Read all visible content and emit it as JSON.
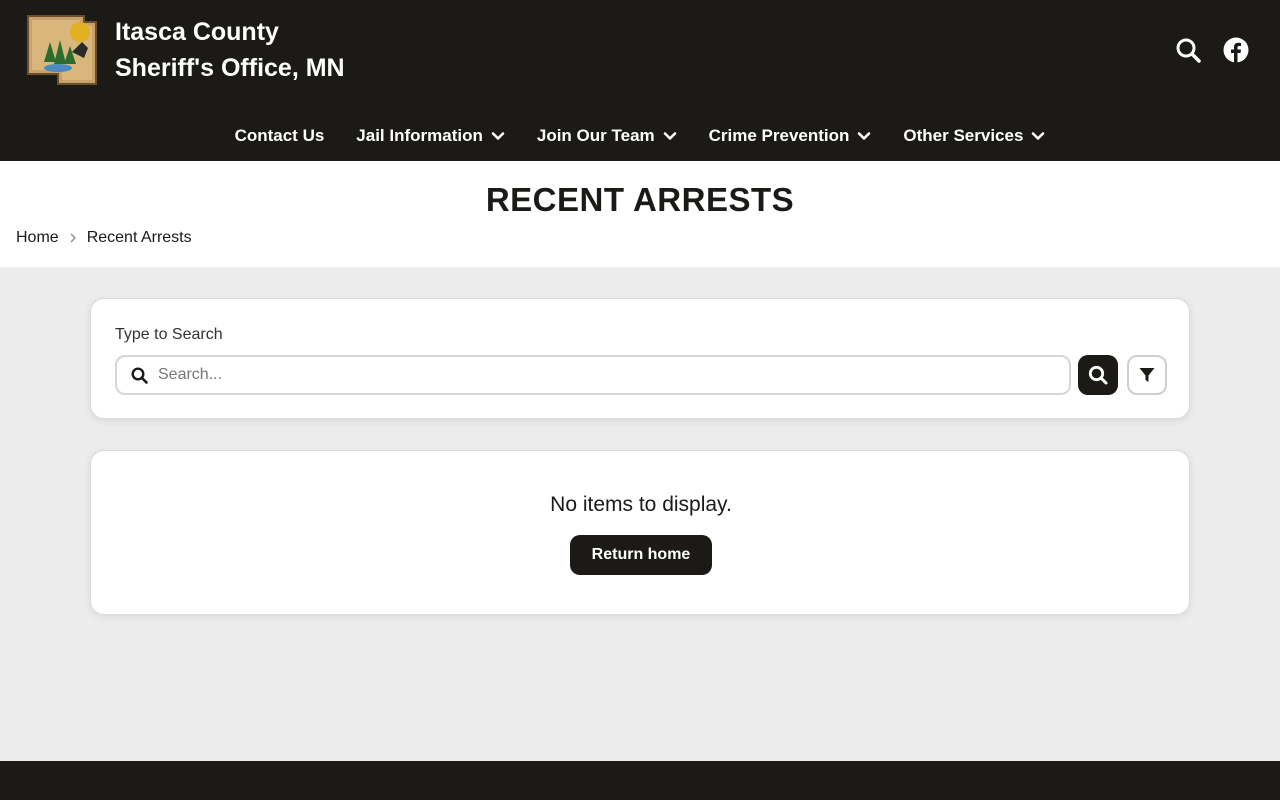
{
  "site": {
    "title_line1": "Itasca County",
    "title_line2": "Sheriff's Office, MN",
    "logo_icon": "sheriff-badge-logo",
    "colors": {
      "primary": "#1b1a17",
      "background": "#ececec",
      "white": "#ffffff"
    }
  },
  "header_icons": {
    "search": "search-icon",
    "facebook": "facebook-icon"
  },
  "nav": {
    "items": [
      {
        "label": "Contact Us",
        "has_dropdown": false
      },
      {
        "label": "Jail Information",
        "has_dropdown": true
      },
      {
        "label": "Join Our Team",
        "has_dropdown": true
      },
      {
        "label": "Crime Prevention",
        "has_dropdown": true
      },
      {
        "label": "Other Services",
        "has_dropdown": true
      }
    ]
  },
  "page": {
    "title": "RECENT ARRESTS",
    "breadcrumb": {
      "home": "Home",
      "current": "Recent Arrests"
    }
  },
  "search": {
    "label": "Type to Search",
    "placeholder": "Search...",
    "value": ""
  },
  "results": {
    "empty_message": "No items to display.",
    "return_button": "Return home"
  }
}
